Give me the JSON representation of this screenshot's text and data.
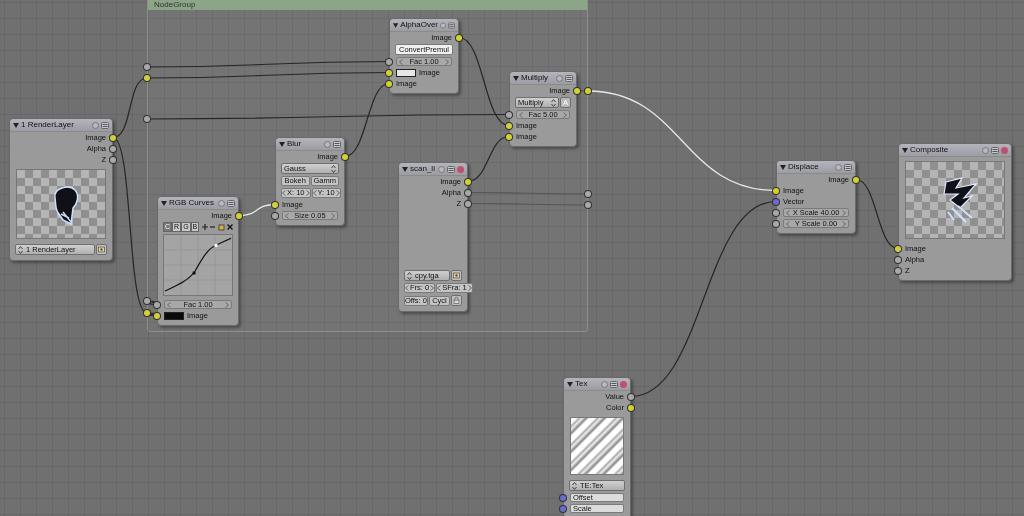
{
  "group": {
    "title": "NodeGroup",
    "inputs": [
      {
        "color": "#a8a8a8"
      },
      {
        "color": "#d2d22c"
      },
      {
        "color": "#a8a8a8"
      },
      {
        "color": "#a8a8a8"
      },
      {
        "color": "#d2d22c"
      }
    ],
    "outputs": [
      {
        "color": "#d2d22c"
      },
      {
        "color": "#a8a8a8"
      },
      {
        "color": "#a8a8a8"
      }
    ]
  },
  "nodes": [
    {
      "title": "1 RenderLayer",
      "outputs": [
        {
          "label": "Image",
          "color": "#d2d22c"
        },
        {
          "label": "Alpha",
          "color": "#a8a8a8"
        },
        {
          "label": "Z",
          "color": "#a8a8a8"
        }
      ],
      "widgets": [
        {
          "kind": "render"
        },
        {
          "kind": "select",
          "label": "1 RenderLayer",
          "icon_button": true
        }
      ]
    },
    {
      "title": "RGB Curves",
      "outputs": [
        {
          "label": "Image",
          "color": "#d2d22c"
        }
      ],
      "widgets": [
        {
          "kind": "curves",
          "channels": [
            {
              "label": "C",
              "selected": true
            },
            {
              "label": "R",
              "selected": false
            },
            {
              "label": "G",
              "selected": false
            },
            {
              "label": "B",
              "selected": false
            }
          ]
        }
      ],
      "inputs": [
        {
          "label": "Fac 1.00",
          "color": "#a8a8a8",
          "kind": "slider"
        },
        {
          "label": "Image",
          "color": "#d2d22c",
          "kind": "swatch",
          "swatch": {
            "color": "#0a0a0a"
          }
        }
      ]
    },
    {
      "title": "Blur",
      "outputs": [
        {
          "label": "Image",
          "color": "#d2d22c"
        }
      ],
      "widgets": [
        {
          "kind": "menu",
          "label": "Gauss"
        },
        {
          "kind": "buttons",
          "items": [
            {
              "label": "Bokeh"
            },
            {
              "label": "Gamm"
            }
          ]
        },
        {
          "kind": "numbers",
          "items": [
            {
              "label": "X: 10"
            },
            {
              "label": "Y: 10"
            }
          ]
        }
      ],
      "inputs": [
        {
          "label": "Image",
          "color": "#d2d22c",
          "kind": "plain"
        },
        {
          "label": "Size 0.05",
          "color": "#a8a8a8",
          "kind": "slider"
        }
      ]
    },
    {
      "title": "AlphaOver",
      "outputs": [
        {
          "label": "Image",
          "color": "#d2d22c"
        }
      ],
      "widgets": [
        {
          "kind": "button",
          "label": "ConvertPremul"
        }
      ],
      "inputs": [
        {
          "label": "Fac 1.00",
          "color": "#a8a8a8",
          "kind": "slider"
        },
        {
          "label": "Image",
          "color": "#d2d22c",
          "kind": "swatch",
          "swatch": {
            "color": "#e6e6e6"
          }
        },
        {
          "label": "Image",
          "color": "#d2d22c",
          "kind": "plain"
        }
      ]
    },
    {
      "title": "Multiply",
      "outputs": [
        {
          "label": "Image",
          "color": "#d2d22c"
        }
      ],
      "widgets": [
        {
          "kind": "menu",
          "label": "Multiply",
          "toggle": "A"
        }
      ],
      "inputs": [
        {
          "label": "Fac 5.00",
          "color": "#a8a8a8",
          "kind": "slider"
        },
        {
          "label": "Image",
          "color": "#d2d22c",
          "kind": "plain"
        },
        {
          "label": "Image",
          "color": "#d2d22c",
          "kind": "plain"
        }
      ]
    },
    {
      "title": "scan_li",
      "removable": true,
      "outputs": [
        {
          "label": "Image",
          "color": "#d2d22c"
        },
        {
          "label": "Alpha",
          "color": "#a8a8a8"
        },
        {
          "label": "Z",
          "color": "#a8a8a8"
        }
      ],
      "widgets": [
        {
          "kind": "select",
          "label": "cpy.tga",
          "icon_button": true
        },
        {
          "kind": "numbers",
          "items": [
            {
              "label": "Frs: 0"
            },
            {
              "label": "SFra: 1"
            }
          ]
        },
        {
          "kind": "buttons",
          "items": [
            {
              "label": "Offs: 0"
            },
            {
              "label": "Cycl"
            }
          ],
          "icon_button": true
        }
      ]
    },
    {
      "title": "Displace",
      "outputs": [
        {
          "label": "Image",
          "color": "#d2d22c"
        }
      ],
      "inputs": [
        {
          "label": "Image",
          "color": "#d2d22c",
          "kind": "plain"
        },
        {
          "label": "Vector",
          "color": "#6a6ad0",
          "kind": "plain"
        },
        {
          "label": "X Scale 40.00",
          "color": "#a8a8a8",
          "kind": "slider"
        },
        {
          "label": "Y Scale 0.00",
          "color": "#a8a8a8",
          "kind": "slider"
        }
      ]
    },
    {
      "title": "Composite",
      "removable": true,
      "widgets": [
        {
          "kind": "composite"
        }
      ],
      "inputs": [
        {
          "label": "Image",
          "color": "#d2d22c",
          "kind": "plain"
        },
        {
          "label": "Alpha",
          "color": "#a8a8a8",
          "kind": "plain"
        },
        {
          "label": "Z",
          "color": "#a8a8a8",
          "kind": "plain"
        }
      ]
    },
    {
      "title": "Tex",
      "removable": true,
      "outputs": [
        {
          "label": "Value",
          "color": "#a8a8a8"
        },
        {
          "label": "Color",
          "color": "#d2d22c"
        }
      ],
      "widgets": [
        {
          "kind": "texture"
        },
        {
          "kind": "select",
          "label": "TE:Tex"
        }
      ],
      "inputs": [
        {
          "label": "Offset",
          "color": "#6a6ad0",
          "kind": "field"
        },
        {
          "label": "Scale",
          "color": "#6a6ad0",
          "kind": "field"
        }
      ]
    }
  ]
}
